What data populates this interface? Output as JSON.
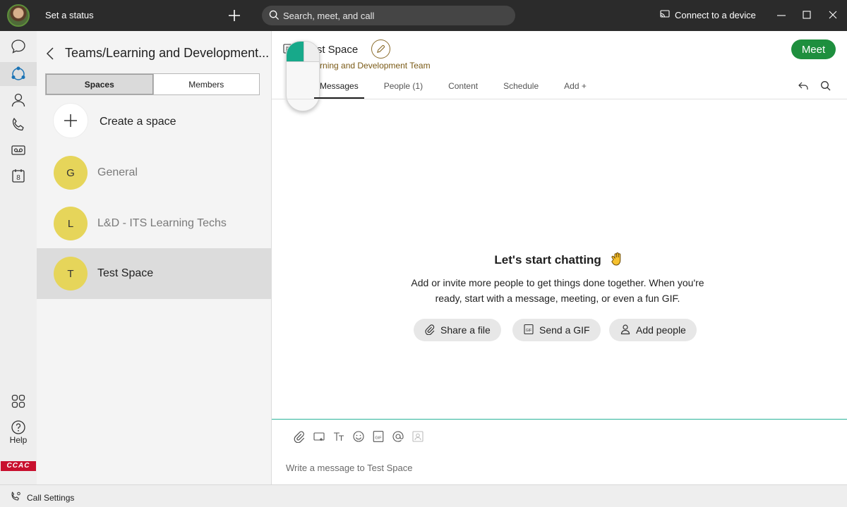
{
  "titlebar": {
    "status_label": "Set a status",
    "search_placeholder": "Search, meet, and call",
    "connect_label": "Connect to a device"
  },
  "rail": {
    "help_label": "Help",
    "calendar_day": "8",
    "logo_text": "CCAC"
  },
  "panel": {
    "title": "Teams/Learning and Development...",
    "seg_spaces": "Spaces",
    "seg_members": "Members",
    "create_label": "Create a space",
    "spaces": [
      {
        "initial": "G",
        "name": "General"
      },
      {
        "initial": "L",
        "name": "L&D - ITS Learning Techs"
      },
      {
        "initial": "T",
        "name": "Test Space"
      }
    ]
  },
  "main": {
    "space_title": "Test Space",
    "team_label": "Learning and Development Team",
    "meet_label": "Meet",
    "tabs": [
      "Messages",
      "People (1)",
      "Content",
      "Schedule",
      "Add +"
    ],
    "empty_title": "Let's start chatting",
    "empty_text": "Add or invite more people to get things done together. When you're ready, start with a message, meeting, or even a fun GIF.",
    "share_file": "Share a file",
    "send_gif": "Send a GIF",
    "add_people": "Add people",
    "compose_placeholder": "Write a message to Test Space"
  },
  "bottombar": {
    "call_settings": "Call Settings"
  },
  "colors": {
    "accent_green": "#1e8f3e",
    "space_yellow": "#e6d55a",
    "compose_line": "#2bb39a"
  }
}
